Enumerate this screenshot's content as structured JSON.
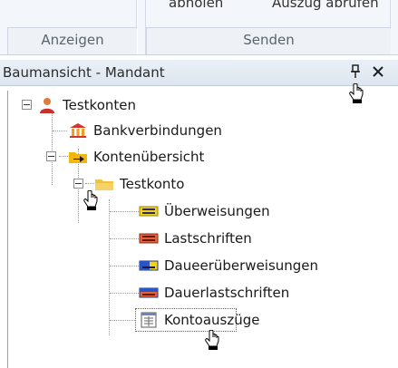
{
  "ribbon": {
    "top_left_text": "abholen",
    "top_right_text": "Auszug abrufen",
    "groups": [
      {
        "label": "Anzeigen"
      },
      {
        "label": "Senden"
      }
    ]
  },
  "panel": {
    "title": "Baumansicht - Mandant"
  },
  "tree": {
    "root": "Testkonten",
    "bankverbindungen": "Bankverbindungen",
    "kontenuebersicht": "Kontenübersicht",
    "testkonto": "Testkonto",
    "children": [
      {
        "label": "Überweisungen"
      },
      {
        "label": "Lastschriften"
      },
      {
        "label": "Daueerüberweisungen"
      },
      {
        "label": "Dauerlastschriften"
      },
      {
        "label": "Kontoauszüge"
      }
    ]
  }
}
